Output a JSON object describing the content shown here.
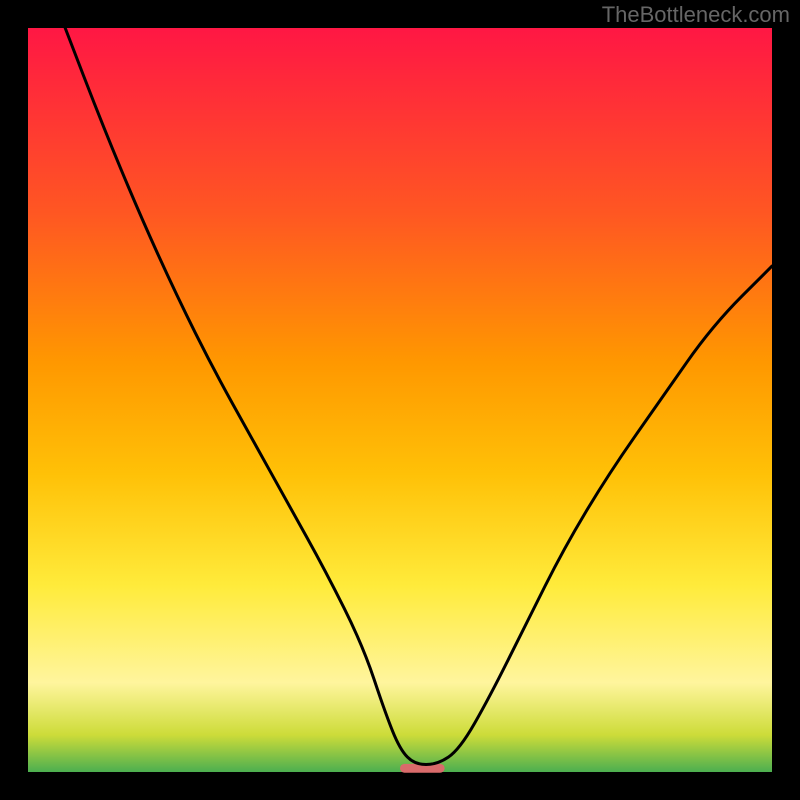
{
  "watermark": "TheBottleneck.com",
  "chart_data": {
    "type": "line",
    "title": "",
    "xlabel": "",
    "ylabel": "",
    "xlim": [
      0,
      100
    ],
    "ylim": [
      0,
      100
    ],
    "background_gradient": {
      "stops": [
        {
          "offset": 0,
          "color": "#ff1744"
        },
        {
          "offset": 25,
          "color": "#ff5722"
        },
        {
          "offset": 45,
          "color": "#ff9800"
        },
        {
          "offset": 60,
          "color": "#ffc107"
        },
        {
          "offset": 75,
          "color": "#ffeb3b"
        },
        {
          "offset": 88,
          "color": "#fff59d"
        },
        {
          "offset": 95,
          "color": "#cddc39"
        },
        {
          "offset": 100,
          "color": "#4caf50"
        }
      ]
    },
    "series": [
      {
        "name": "bottleneck-curve",
        "type": "line",
        "color": "#000000",
        "points": [
          {
            "x": 5,
            "y": 100
          },
          {
            "x": 10,
            "y": 87
          },
          {
            "x": 15,
            "y": 75
          },
          {
            "x": 20,
            "y": 64
          },
          {
            "x": 25,
            "y": 54
          },
          {
            "x": 30,
            "y": 45
          },
          {
            "x": 35,
            "y": 36
          },
          {
            "x": 40,
            "y": 27
          },
          {
            "x": 45,
            "y": 17
          },
          {
            "x": 48,
            "y": 8
          },
          {
            "x": 50,
            "y": 3
          },
          {
            "x": 52,
            "y": 1
          },
          {
            "x": 55,
            "y": 1
          },
          {
            "x": 58,
            "y": 3
          },
          {
            "x": 62,
            "y": 10
          },
          {
            "x": 67,
            "y": 20
          },
          {
            "x": 72,
            "y": 30
          },
          {
            "x": 78,
            "y": 40
          },
          {
            "x": 85,
            "y": 50
          },
          {
            "x": 92,
            "y": 60
          },
          {
            "x": 100,
            "y": 68
          }
        ]
      }
    ],
    "marker": {
      "x": 53,
      "y": 0.5,
      "color": "#d96b6b",
      "width": 6,
      "height": 1.2
    },
    "frame": {
      "color": "#000000",
      "thickness": 28
    }
  }
}
